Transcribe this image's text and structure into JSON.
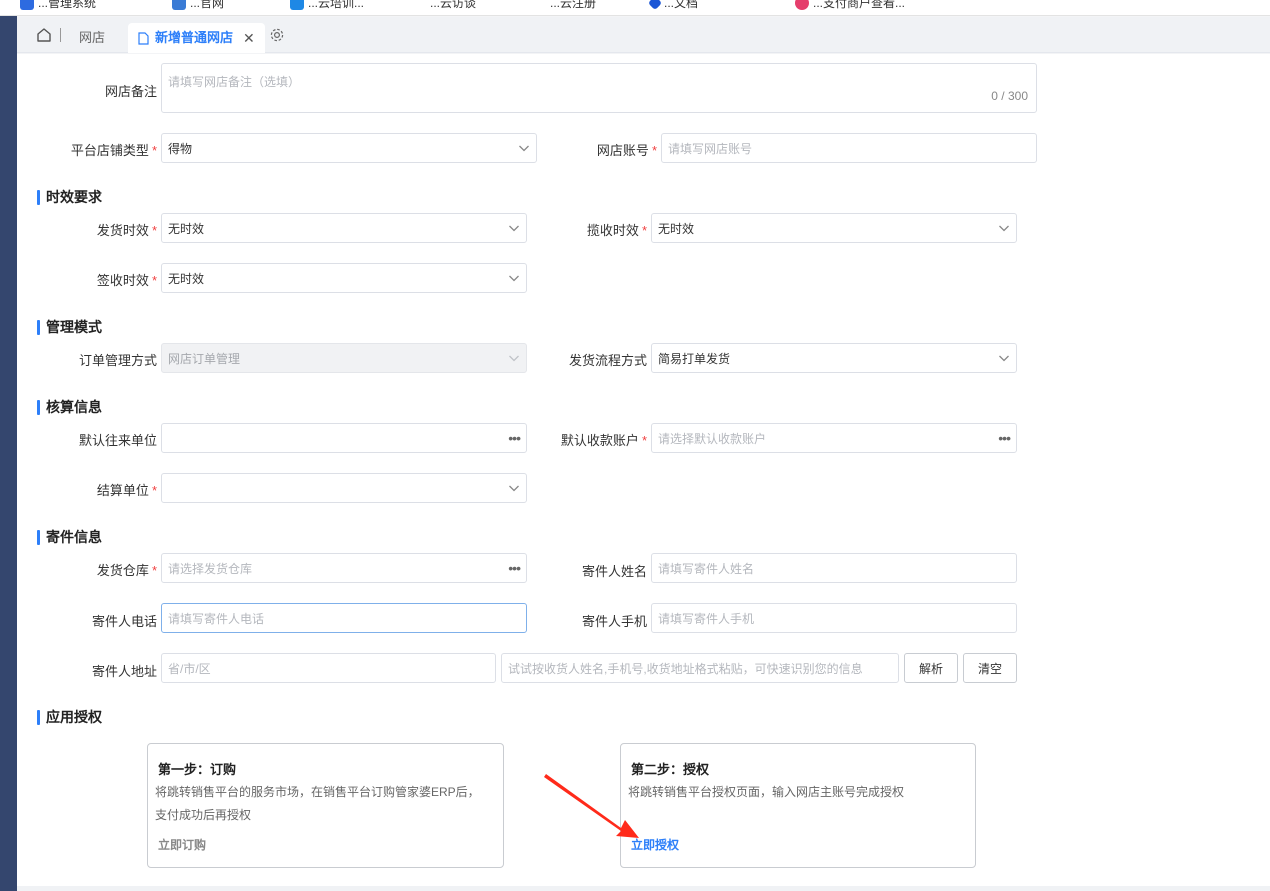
{
  "bookmarks": [
    {
      "label": "...管理系统",
      "color": "#2d6be0"
    },
    {
      "label": "...官网",
      "color": "#3a7bd5"
    },
    {
      "label": "...云培训...",
      "color": "#1e88e5"
    },
    {
      "label": "...云访谈",
      "color": "#888888"
    },
    {
      "label": "...云注册",
      "color": "#888888"
    },
    {
      "label": "...文档",
      "color": "#1a56d6"
    },
    {
      "label": "...支付商户查看...",
      "color": "#e53e6c"
    }
  ],
  "tabs": {
    "home_icon": "home-icon",
    "tab1": "网店",
    "tab2": "新增普通网店",
    "close": "✕",
    "settings_icon": "gear-icon"
  },
  "form": {
    "remark": {
      "label": "网店备注",
      "placeholder": "请填写网店备注（选填）",
      "counter": "0 / 300"
    },
    "platform_type": {
      "label": "平台店铺类型",
      "value": "得物"
    },
    "account": {
      "label": "网店账号",
      "placeholder": "请填写网店账号"
    },
    "req_mark": "*"
  },
  "sections": {
    "timing": "时效要求",
    "management": "管理模式",
    "accounting": "核算信息",
    "sender": "寄件信息",
    "auth": "应用授权"
  },
  "timing": {
    "ship": {
      "label": "发货时效",
      "value": "无时效"
    },
    "pickup": {
      "label": "揽收时效",
      "value": "无时效"
    },
    "sign": {
      "label": "签收时效",
      "value": "无时效"
    }
  },
  "management": {
    "order_mode": {
      "label": "订单管理方式",
      "value": "网店订单管理"
    },
    "ship_flow": {
      "label": "发货流程方式",
      "value": "简易打单发货"
    }
  },
  "accounting": {
    "partner": {
      "label": "默认往来单位",
      "value": ""
    },
    "account": {
      "label": "默认收款账户",
      "placeholder": "请选择默认收款账户"
    },
    "settle": {
      "label": "结算单位",
      "value": ""
    }
  },
  "sender": {
    "warehouse": {
      "label": "发货仓库",
      "placeholder": "请选择发货仓库"
    },
    "name": {
      "label": "寄件人姓名",
      "placeholder": "请填写寄件人姓名"
    },
    "phone": {
      "label": "寄件人电话",
      "placeholder": "请填写寄件人电话"
    },
    "mobile": {
      "label": "寄件人手机",
      "placeholder": "请填写寄件人手机"
    },
    "address": {
      "label": "寄件人地址",
      "region_placeholder": "省/市/区",
      "paste_placeholder": "试试按收货人姓名,手机号,收货地址格式粘贴，可快速识别您的信息"
    },
    "parse_btn": "解析",
    "clear_btn": "清空"
  },
  "auth": {
    "step1": {
      "title": "第一步：订购",
      "desc1": "将跳转销售平台的服务市场，在销售平台订购管家婆ERP后，",
      "desc2": "支付成功后再授权",
      "link": "立即订购",
      "link_color": "#888888"
    },
    "step2": {
      "title": "第二步：授权",
      "desc1": "将跳转销售平台授权页面，输入网店主账号完成授权",
      "link": "立即授权",
      "link_color": "#2d7ff9"
    }
  },
  "colors": {
    "accent": "#2d7ff9",
    "required": "#f04040",
    "sidebar": "#34466e",
    "arrow": "#ff2a1a"
  }
}
